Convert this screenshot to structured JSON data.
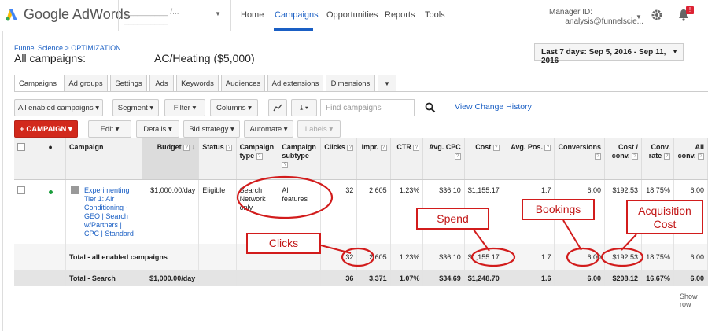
{
  "app": {
    "name": "Google AdWords",
    "account_masked": "__________ /... __________"
  },
  "nav": {
    "items": [
      "Home",
      "Campaigns",
      "Opportunities",
      "Reports",
      "Tools"
    ],
    "active": "Campaigns"
  },
  "manager": {
    "label": "Manager ID:",
    "email": "analysis@funnelscie..."
  },
  "notifications": {
    "count": "!"
  },
  "breadcrumb": "Funnel Science > OPTIMIZATION",
  "page_title": "All campaigns:",
  "subtitle": "AC/Heating ($5,000)",
  "date_range": "Last 7 days: Sep 5, 2016 - Sep 11, 2016",
  "tabs": [
    "Campaigns",
    "Ad groups",
    "Settings",
    "Ads",
    "Keywords",
    "Audiences",
    "Ad extensions",
    "Dimensions"
  ],
  "toolbar1": {
    "filter_all": "All enabled campaigns",
    "segment": "Segment",
    "filter": "Filter",
    "columns": "Columns",
    "search_placeholder": "Find campaigns",
    "view_change_history": "View Change History"
  },
  "toolbar2": {
    "campaign": "CAMPAIGN",
    "edit": "Edit",
    "details": "Details",
    "bid_strategy": "Bid strategy",
    "automate": "Automate",
    "labels": "Labels"
  },
  "columns": [
    "Campaign",
    "Budget",
    "Status",
    "Campaign type",
    "Campaign subtype",
    "Clicks",
    "Impr.",
    "CTR",
    "Avg. CPC",
    "Cost",
    "Avg. Pos.",
    "Conversions",
    "Cost / conv.",
    "Conv. rate",
    "All conv."
  ],
  "row": {
    "campaign": "Experimenting Tier 1: Air Conditioning - GEO | Search w/Partners | CPC | Standard",
    "budget": "$1,000.00/day",
    "status": "Eligible",
    "type": "Search Network only",
    "subtype": "All features",
    "clicks": "32",
    "impr": "2,605",
    "ctr": "1.23%",
    "avg_cpc": "$36.10",
    "cost": "$1,155.17",
    "avg_pos": "1.7",
    "conversions": "6.00",
    "cost_conv": "$192.53",
    "conv_rate": "18.75%",
    "all_conv": "6.00"
  },
  "total_enabled": {
    "label": "Total - all enabled campaigns",
    "clicks": "32",
    "impr": "2,605",
    "ctr": "1.23%",
    "avg_cpc": "$36.10",
    "cost": "$1,155.17",
    "avg_pos": "1.7",
    "conversions": "6.00",
    "cost_conv": "$192.53",
    "conv_rate": "18.75%",
    "all_conv": "6.00"
  },
  "total_search": {
    "label": "Total - Search",
    "budget": "$1,000.00/day",
    "clicks": "36",
    "impr": "3,371",
    "ctr": "1.07%",
    "avg_cpc": "$34.69",
    "cost": "$1,248.70",
    "avg_pos": "1.6",
    "conversions": "6.00",
    "cost_conv": "$208.12",
    "conv_rate": "16.67%",
    "all_conv": "6.00"
  },
  "show_rows": "Show row",
  "annotations": {
    "clicks": "Clicks",
    "spend": "Spend",
    "bookings": "Bookings",
    "acquisition_cost": "Acquisition Cost"
  },
  "colors": {
    "accent": "#1a5fc4",
    "danger": "#d2291c",
    "annotation": "#d21c1c"
  }
}
